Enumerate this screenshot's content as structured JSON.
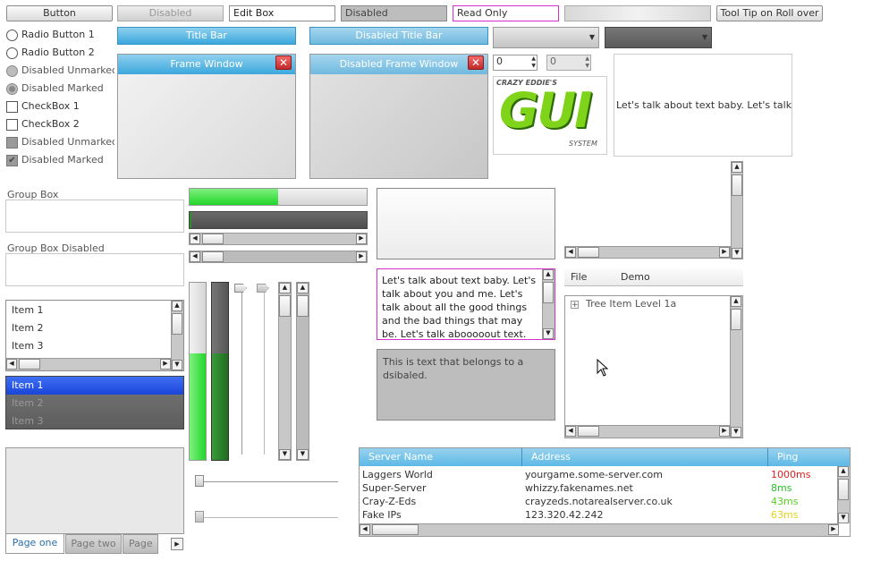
{
  "row1": {
    "button": "Button",
    "disabled_button": "Disabled",
    "edit_box": "Edit Box",
    "disabled_edit": "Disabled",
    "readonly_edit": "Read Only",
    "tooltip_button": "Tool Tip on Roll over"
  },
  "radios": [
    "Radio Button 1",
    "Radio Button 2",
    "Disabled Unmarked",
    "Disabled Marked"
  ],
  "checks": [
    "CheckBox 1",
    "CheckBox 2",
    "Disabled Unmarked",
    "Disabled Marked"
  ],
  "titlebars": {
    "enabled": "Title Bar",
    "disabled": "Disabled Title Bar"
  },
  "frames": {
    "enabled": "Frame Window",
    "disabled": "Disabled Frame Window",
    "close_glyph": "✕"
  },
  "spinners": {
    "enabled_value": "0",
    "disabled_value": "0"
  },
  "logo": {
    "line1": "CRAZY EDDIE'S",
    "line2": "GUI",
    "line3": "SYSTEM"
  },
  "static_text": "Let's talk about text baby. Let's talk al",
  "group_boxes": {
    "enabled": "Group Box",
    "disabled": "Group Box Disabled"
  },
  "progress": {
    "enabled_fraction": 0.5,
    "disabled_fraction": 0.0
  },
  "list1": [
    "Item 1",
    "Item 2",
    "Item 3"
  ],
  "list2": [
    "Item 1",
    "Item 2",
    "Item 3"
  ],
  "multiline": "Let's talk about text baby. Let's talk about you and me. Let's talk about all the good things and the bad things that may be. Let's talk abooooout text. Let's talk about",
  "disabled_multiline": "This is text that belongs to a dsibaled.",
  "menubar": {
    "file": "File",
    "demo": "Demo"
  },
  "tree": {
    "item": "Tree Item Level 1a",
    "expander": "+"
  },
  "tabs": [
    "Page one",
    "Page two",
    "Page t"
  ],
  "vertical_bars": {
    "enabled_fraction": 0.6,
    "disabled_fraction": 0.6
  },
  "multicolumn": {
    "headers": [
      "Server Name",
      "Address",
      "Ping"
    ],
    "rows": [
      {
        "name": "Laggers World",
        "address": "yourgame.some-server.com",
        "ping": "1000ms",
        "ping_color": "#e01f1f"
      },
      {
        "name": "Super-Server",
        "address": "whizzy.fakenames.net",
        "ping": "8ms",
        "ping_color": "#27c427"
      },
      {
        "name": "Cray-Z-Eds",
        "address": "crayzeds.notarealserver.co.uk",
        "ping": "43ms",
        "ping_color": "#55d21f"
      },
      {
        "name": "Fake IPs",
        "address": "123.320.42.242",
        "ping": "63ms",
        "ping_color": "#e3d21a"
      }
    ]
  },
  "colors": {
    "accent": "#3ba7dc",
    "progress_green": "#2ee84a",
    "selection_blue": "#1f4fe6",
    "readonly_border": "#d42fc9"
  }
}
